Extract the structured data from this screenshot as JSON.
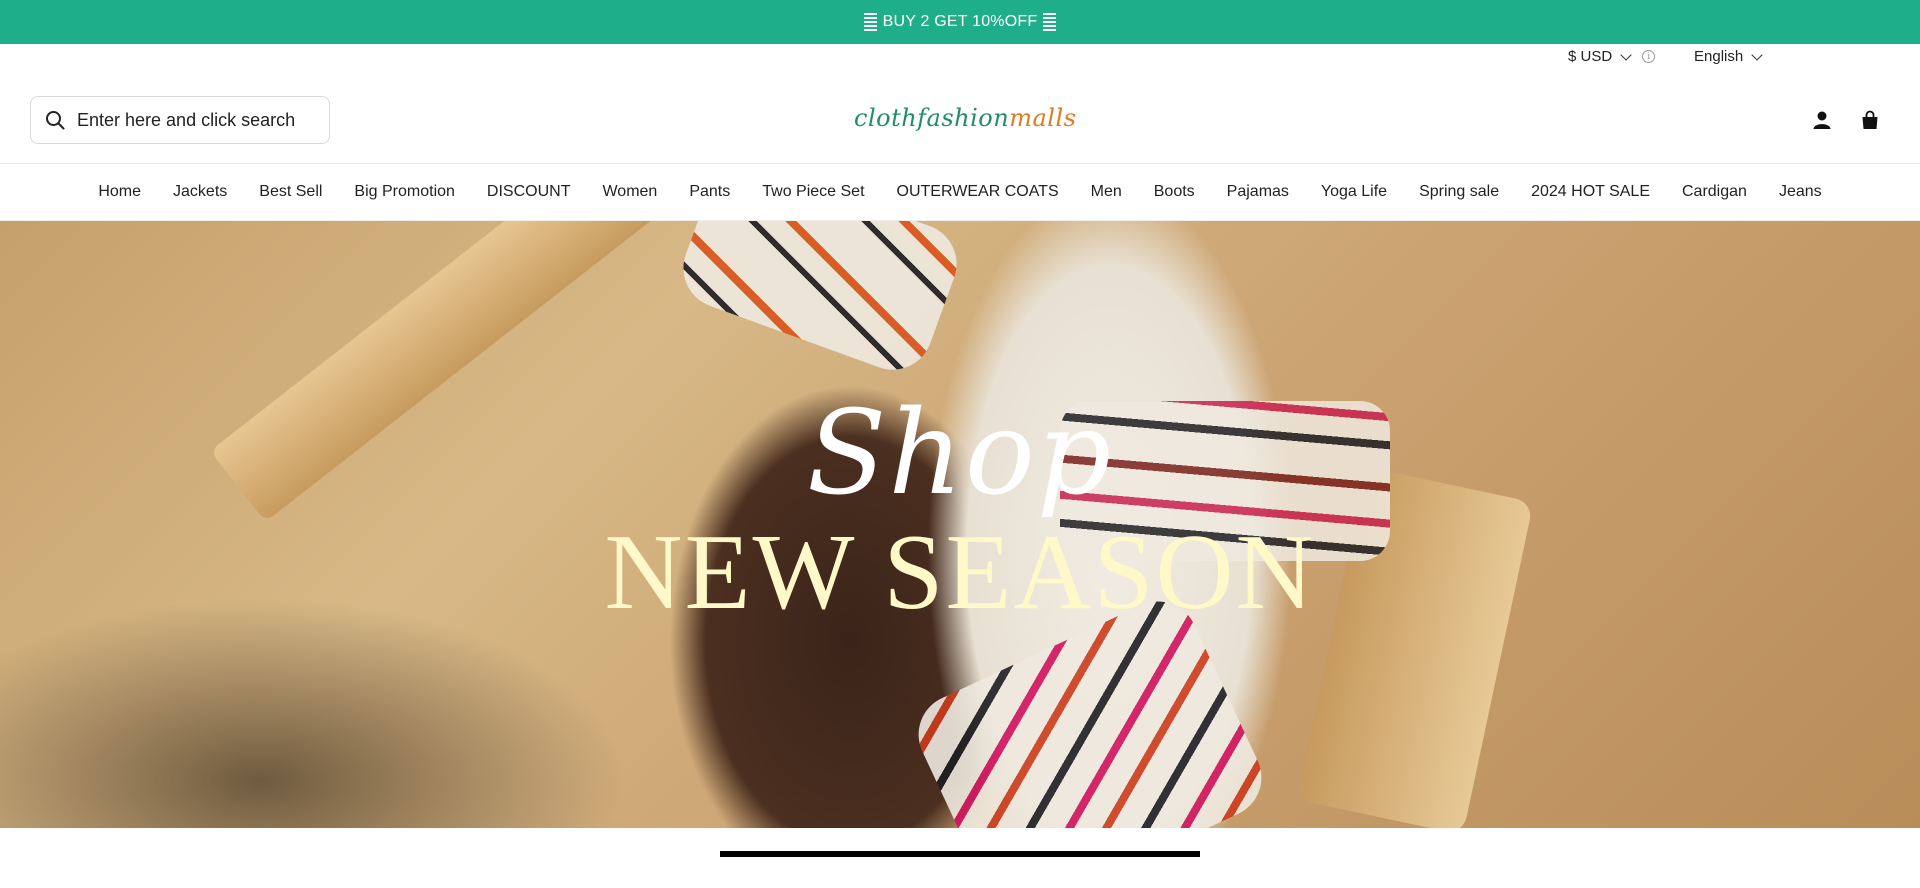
{
  "announcement": {
    "text": "BUY 2 GET 10%OFF"
  },
  "utility": {
    "currency": "$ USD",
    "language": "English"
  },
  "search": {
    "placeholder": "Enter here and click search"
  },
  "logo": {
    "part1": "clothfashion",
    "part2": "malls"
  },
  "nav": {
    "items": [
      "Home",
      "Jackets",
      "Best Sell",
      "Big Promotion",
      "DISCOUNT",
      "Women",
      "Pants",
      "Two Piece Set",
      "OUTERWEAR COATS",
      "Men",
      "Boots",
      "Pajamas",
      "Yoga Life",
      "Spring sale",
      "2024 HOT SALE",
      "Cardigan",
      "Jeans"
    ]
  },
  "hero": {
    "script": "Shop",
    "headline": "NEW SEASON"
  },
  "colors": {
    "announcement_bg": "#1fae8a",
    "logo_green": "#1f8f62",
    "logo_orange": "#e07a1f",
    "headline": "#fff8c8"
  },
  "icons": [
    "search-icon",
    "account-icon",
    "cart-icon",
    "info-icon",
    "chevron-down-icon"
  ]
}
